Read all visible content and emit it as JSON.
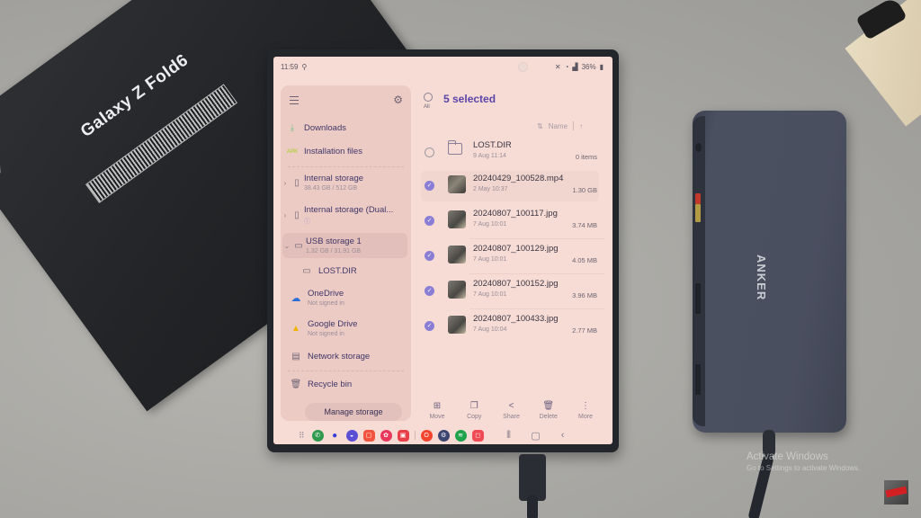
{
  "scene": {
    "box_brand": "Galaxy Z Fold6",
    "hub_brand": "ANKER",
    "watermark": {
      "line1": "Activate Windows",
      "line2": "Go to Settings to activate Windows."
    }
  },
  "statusbar": {
    "time": "11:59",
    "battery": "36%"
  },
  "drawer": {
    "menu_icon": "hamburger-icon",
    "settings_icon": "gear-icon",
    "items": [
      {
        "label": "Downloads",
        "icon": "download-icon"
      },
      {
        "label": "Installation files",
        "icon": "apk-icon",
        "icon_text": "APK"
      },
      {
        "label": "Internal storage",
        "sub": "38.43 GB / 512 GB",
        "icon": "phone-icon"
      },
      {
        "label": "Internal storage (Dual...",
        "sub": "ⓘ",
        "icon": "phone-dual-icon"
      },
      {
        "label": "USB storage 1",
        "sub": "1.32 GB / 31.91 GB",
        "icon": "usb-icon",
        "selected": true
      },
      {
        "label": "LOST.DIR",
        "icon": "folder-icon"
      },
      {
        "label": "OneDrive",
        "sub": "Not signed in",
        "icon": "onedrive-icon"
      },
      {
        "label": "Google Drive",
        "sub": "Not signed in",
        "icon": "google-drive-icon"
      },
      {
        "label": "Network storage",
        "icon": "network-storage-icon"
      },
      {
        "label": "Recycle bin",
        "icon": "trash-icon"
      }
    ],
    "manage_button": "Manage storage"
  },
  "list": {
    "select_all_label": "All",
    "selection_title": "5 selected",
    "sort_label": "Name",
    "files": [
      {
        "name": "LOST.DIR",
        "date": "9 Aug 11:14",
        "size": "0 items",
        "type": "folder",
        "checked": false
      },
      {
        "name": "20240429_100528.mp4",
        "date": "2 May 10:37",
        "size": "1.30 GB",
        "type": "video",
        "checked": true
      },
      {
        "name": "20240807_100117.jpg",
        "date": "7 Aug 10:01",
        "size": "3.74 MB",
        "type": "image",
        "checked": true
      },
      {
        "name": "20240807_100129.jpg",
        "date": "7 Aug 10:01",
        "size": "4.05 MB",
        "type": "image",
        "checked": true
      },
      {
        "name": "20240807_100152.jpg",
        "date": "7 Aug 10:01",
        "size": "3.96 MB",
        "type": "image",
        "checked": true
      },
      {
        "name": "20240807_100433.jpg",
        "date": "7 Aug 10:04",
        "size": "2.77 MB",
        "type": "image",
        "checked": true
      }
    ]
  },
  "actions": [
    {
      "label": "Move",
      "icon": "move-icon"
    },
    {
      "label": "Copy",
      "icon": "copy-icon"
    },
    {
      "label": "Share",
      "icon": "share-icon"
    },
    {
      "label": "Delete",
      "icon": "delete-icon"
    },
    {
      "label": "More",
      "icon": "more-icon"
    }
  ],
  "taskbar": {
    "apps": [
      {
        "name": "phone",
        "color": "#2f9a4e"
      },
      {
        "name": "messages",
        "color": "#3b3fd1"
      },
      {
        "name": "internet",
        "color": "#5b4fd6"
      },
      {
        "name": "notes",
        "color": "#f2553f"
      },
      {
        "name": "gallery",
        "color": "#e8375b"
      },
      {
        "name": "screen-recorder",
        "color": "#e8404a"
      },
      {
        "name": "opera",
        "color": "#f4442e"
      },
      {
        "name": "settings",
        "color": "#3c4670"
      },
      {
        "name": "spotify",
        "color": "#1fa34a"
      },
      {
        "name": "store",
        "color": "#f04b55"
      }
    ]
  },
  "colors": {
    "accent": "#5a45a8",
    "checkbox": "#8a7dd6",
    "screen_bg": "#f6dcd5",
    "drawer_bg": "#eccbc5"
  }
}
